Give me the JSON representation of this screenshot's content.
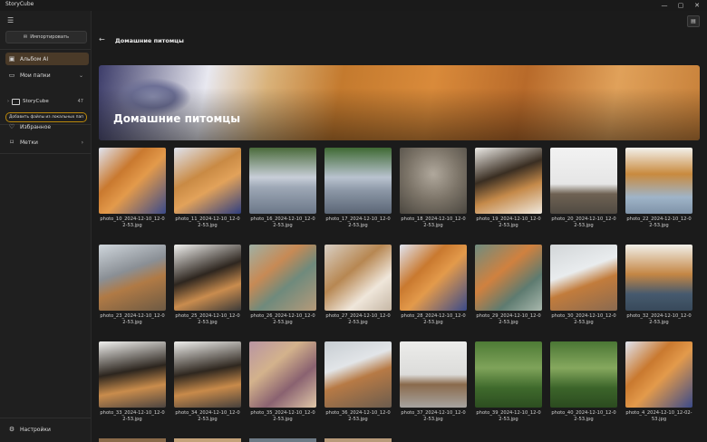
{
  "app": {
    "title": "StoryCube"
  },
  "window": {
    "min": "—",
    "max": "▢",
    "close": "✕"
  },
  "sidebar": {
    "import_label": "Импортировать",
    "items": [
      {
        "label": "Альбом AI",
        "icon": "album-icon"
      },
      {
        "label": "Мои папки",
        "icon": "folder-icon"
      },
      {
        "label": "Избранное",
        "icon": "heart-icon"
      },
      {
        "label": "Метки",
        "icon": "tag-icon"
      },
      {
        "label": "Настройки",
        "icon": "gear-icon"
      }
    ],
    "tree": {
      "label": "StoryCube",
      "count": "47"
    },
    "add_files_label": "Добавить файлы из локальных пап"
  },
  "main": {
    "page_title": "Домашние питомцы",
    "banner_title": "Домашние питомцы"
  },
  "photos": [
    {
      "name": "photo_10_2024-12-10_12-02-53.jpg"
    },
    {
      "name": "photo_11_2024-12-10_12-02-53.jpg"
    },
    {
      "name": "photo_16_2024-12-10_12-02-53.jpg"
    },
    {
      "name": "photo_17_2024-12-10_12-02-53.jpg"
    },
    {
      "name": "photo_18_2024-12-10_12-02-53.jpg"
    },
    {
      "name": "photo_19_2024-12-10_12-02-53.jpg"
    },
    {
      "name": "photo_20_2024-12-10_12-02-53.jpg"
    },
    {
      "name": "photo_22_2024-12-10_12-02-53.jpg"
    },
    {
      "name": "photo_23_2024-12-10_12-02-53.jpg"
    },
    {
      "name": "photo_25_2024-12-10_12-02-53.jpg"
    },
    {
      "name": "photo_26_2024-12-10_12-02-53.jpg"
    },
    {
      "name": "photo_27_2024-12-10_12-02-53.jpg"
    },
    {
      "name": "photo_28_2024-12-10_12-02-53.jpg"
    },
    {
      "name": "photo_29_2024-12-10_12-02-53.jpg"
    },
    {
      "name": "photo_30_2024-12-10_12-02-53.jpg"
    },
    {
      "name": "photo_32_2024-12-10_12-02-53.jpg"
    },
    {
      "name": "photo_33_2024-12-10_12-02-53.jpg"
    },
    {
      "name": "photo_34_2024-12-10_12-02-53.jpg"
    },
    {
      "name": "photo_35_2024-12-10_12-02-53.jpg"
    },
    {
      "name": "photo_36_2024-12-10_12-02-53.jpg"
    },
    {
      "name": "photo_37_2024-12-10_12-02-53.jpg"
    },
    {
      "name": "photo_39_2024-12-10_12-02-53.jpg"
    },
    {
      "name": "photo_40_2024-12-10_12-02-53.jpg"
    },
    {
      "name": "photo_4_2024-12-10_12-02-53.jpg"
    }
  ],
  "colors": {
    "accent": "#b8860b",
    "active_bg": "#4a3a28",
    "background": "#1b1b1b"
  }
}
